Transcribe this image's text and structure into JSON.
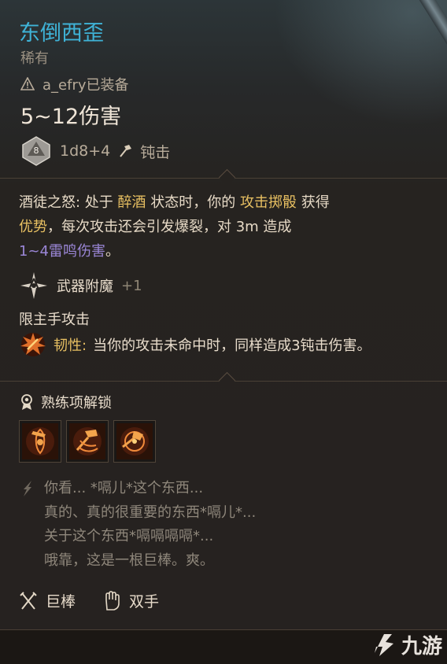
{
  "item": {
    "name": "东倒西歪",
    "rarity": "稀有",
    "equipped_by": "a_efry已装备",
    "damage": "5~12伤害",
    "die_face": "8",
    "dice_formula": "1d8+4",
    "damage_type": "钝击",
    "passive": {
      "name": "酒徒之怒:",
      "t1": " 处于 ",
      "k1": "醉酒",
      "t2": " 状态时，你的 ",
      "k2": "攻击掷骰",
      "t3": " 获得",
      "k3": "优势",
      "t4": "，每次攻击还会引发爆裂，对 3m 造成",
      "k4": "1~4雷鸣伤害",
      "t5": "。"
    },
    "enchantment": {
      "label": "武器附魔",
      "value": "+1"
    },
    "main_hand": "限主手攻击",
    "toughness": {
      "label": "韧性:",
      "text": " 当你的攻击未命中时，同样造成3钝击伤害。"
    },
    "proficiency": {
      "label": "熟练项解锁",
      "actions": [
        "topple-action-icon",
        "weakening-strike-icon",
        "concussive-smash-icon"
      ]
    },
    "flavor": [
      "你看... *嗝儿*这个东西...",
      "真的、真的很重要的东西*嗝儿*...",
      "关于这个东西*嗝嗝嗝嗝*...",
      "哦靠，这是一根巨棒。爽。"
    ],
    "properties": [
      "巨棒",
      "双手"
    ]
  },
  "watermark": {
    "text": "九游"
  },
  "colors": {
    "title": "#3fb3d7",
    "keyword": "#e8c062",
    "thunder": "#9a86d6",
    "flavor": "#8f877b"
  }
}
